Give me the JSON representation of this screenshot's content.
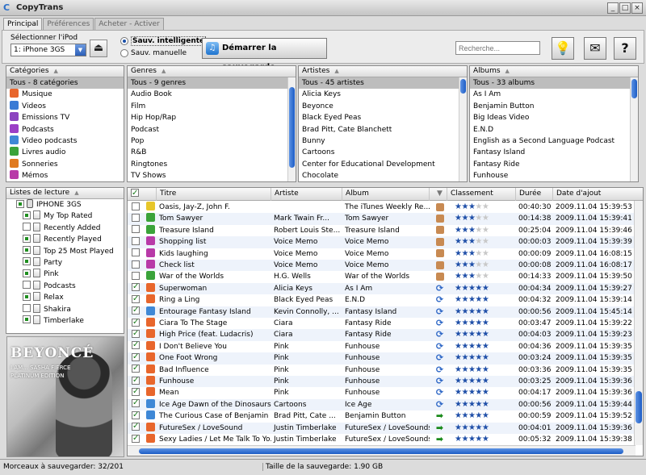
{
  "app": {
    "title": "CopyTrans",
    "window_controls": [
      "_",
      "□",
      "×"
    ]
  },
  "tabs": [
    {
      "label": "Principal"
    },
    {
      "label": "Préférences"
    },
    {
      "label": "Acheter - Activer"
    }
  ],
  "toolbar": {
    "ipod_label": "Sélectionner l'iPod",
    "ipod_selected": "1: iPhone 3GS",
    "radio_smart": "Sauv. intelligente",
    "radio_manual": "Sauv. manuelle",
    "start_label": "Démarrer la sauvegarde",
    "search_placeholder": "Recherche..."
  },
  "categories": {
    "header": "Catégories",
    "items": [
      {
        "label": "Tous - 8 catégories",
        "color": ""
      },
      {
        "label": "Musique",
        "color": "#e8662c"
      },
      {
        "label": "Videos",
        "color": "#3a7bd5"
      },
      {
        "label": "Emissions TV",
        "color": "#8c44c0"
      },
      {
        "label": "Podcasts",
        "color": "#9b3fc6"
      },
      {
        "label": "Video podcasts",
        "color": "#3f88d6"
      },
      {
        "label": "Livres audio",
        "color": "#3aa33a"
      },
      {
        "label": "Sonneries",
        "color": "#e07a1f"
      },
      {
        "label": "Mémos",
        "color": "#b83aa8"
      }
    ]
  },
  "genres": {
    "header": "Genres",
    "items": [
      "Tous - 9 genres",
      "Audio Book",
      "Film",
      "Hip Hop/Rap",
      "Podcast",
      "Pop",
      "R&B",
      "Ringtones",
      "TV Shows"
    ]
  },
  "artists": {
    "header": "Artistes",
    "items": [
      "Tous - 45 artistes",
      "Alicia Keys",
      "Beyonce",
      "Black Eyed Peas",
      "Brad Pitt, Cate Blanchett",
      "Bunny",
      "Cartoons",
      "Center for Educational Development",
      "Chocolate"
    ]
  },
  "albums": {
    "header": "Albums",
    "items": [
      "Tous - 33 albums",
      "As I Am",
      "Benjamin Button",
      "Big Ideas Video",
      "E.N.D",
      "English as a Second Language Podcast",
      "Fantasy Island",
      "Fantasy Ride",
      "Funhouse"
    ]
  },
  "playlists": {
    "header": "Listes de lecture",
    "device": "IPHONE 3GS",
    "items": [
      {
        "label": "My Top Rated",
        "state": "on"
      },
      {
        "label": "Recently Added",
        "state": "off"
      },
      {
        "label": "Recently Played",
        "state": "on"
      },
      {
        "label": "Top 25 Most Played",
        "state": "on"
      },
      {
        "label": "Party",
        "state": "on"
      },
      {
        "label": "Pink",
        "state": "on"
      },
      {
        "label": "Podcasts",
        "state": "off"
      },
      {
        "label": "Relax",
        "state": "on"
      },
      {
        "label": "Shakira",
        "state": "off"
      },
      {
        "label": "Timberlake",
        "state": "on"
      }
    ]
  },
  "album_art": {
    "line1": "BEYONCÉ",
    "line2": "I AM... SASHA FIERCE",
    "line3": "PLATINUM EDITION"
  },
  "tracks": {
    "headers": {
      "title": "Titre",
      "artist": "Artiste",
      "album": "Album",
      "rating": "Classement",
      "duration": "Durée",
      "added": "Date d'ajout"
    },
    "rows": [
      {
        "checked": false,
        "icon": "#e7c62a",
        "title": "Oasis, Jay-Z, John F.",
        "artist": "",
        "album": "The iTunes Weekly Re...",
        "status": "thumb",
        "rating": 3,
        "duration": "00:40:30",
        "added": "2009.11.04 15:39:53"
      },
      {
        "checked": false,
        "icon": "#3aa33a",
        "title": "Tom Sawyer",
        "artist": "Mark Twain      Fr...",
        "album": "Tom Sawyer",
        "status": "thumb",
        "rating": 3,
        "duration": "00:14:38",
        "added": "2009.11.04 15:39:41"
      },
      {
        "checked": false,
        "icon": "#3aa33a",
        "title": "Treasure Island",
        "artist": "Robert Louis Ste...",
        "album": "Treasure Island",
        "status": "thumb",
        "rating": 3,
        "duration": "00:25:04",
        "added": "2009.11.04 15:39:46"
      },
      {
        "checked": false,
        "icon": "#b83aa8",
        "title": "Shopping list",
        "artist": "Voice Memo",
        "album": "Voice Memo",
        "status": "thumb",
        "rating": 3,
        "duration": "00:00:03",
        "added": "2009.11.04 15:39:39"
      },
      {
        "checked": false,
        "icon": "#b83aa8",
        "title": "Kids laughing",
        "artist": "Voice Memo",
        "album": "Voice Memo",
        "status": "thumb",
        "rating": 3,
        "duration": "00:00:09",
        "added": "2009.11.04 16:08:15"
      },
      {
        "checked": false,
        "icon": "#b83aa8",
        "title": "Check list",
        "artist": "Voice Memo",
        "album": "Voice Memo",
        "status": "thumb",
        "rating": 3,
        "duration": "00:00:08",
        "added": "2009.11.04 16:08:17"
      },
      {
        "checked": false,
        "icon": "#3aa33a",
        "title": "War of the Worlds",
        "artist": "H.G. Wells",
        "album": "War of the Worlds",
        "status": "thumb",
        "rating": 3,
        "duration": "00:14:33",
        "added": "2009.11.04 15:39:50"
      },
      {
        "checked": true,
        "icon": "#e8662c",
        "title": "Superwoman",
        "artist": "Alicia Keys",
        "album": "As I Am",
        "status": "sync",
        "rating": 5,
        "duration": "00:04:34",
        "added": "2009.11.04 15:39:27"
      },
      {
        "checked": true,
        "icon": "#e8662c",
        "title": "Ring a Ling",
        "artist": "Black Eyed Peas",
        "album": "E.N.D",
        "status": "sync",
        "rating": 5,
        "duration": "00:04:32",
        "added": "2009.11.04 15:39:14"
      },
      {
        "checked": true,
        "icon": "#3f88d6",
        "title": "Entourage Fantasy Island",
        "artist": "Kevin Connolly, ...",
        "album": "Fantasy Island",
        "status": "sync",
        "rating": 5,
        "duration": "00:00:56",
        "added": "2009.11.04 15:45:14"
      },
      {
        "checked": true,
        "icon": "#e8662c",
        "title": "Ciara To The Stage",
        "artist": "Ciara",
        "album": "Fantasy Ride",
        "status": "sync",
        "rating": 5,
        "duration": "00:03:47",
        "added": "2009.11.04 15:39:22"
      },
      {
        "checked": true,
        "icon": "#e8662c",
        "title": "High Price (feat. Ludacris)",
        "artist": "Ciara",
        "album": "Fantasy Ride",
        "status": "sync",
        "rating": 5,
        "duration": "00:04:03",
        "added": "2009.11.04 15:39:23"
      },
      {
        "checked": true,
        "icon": "#e8662c",
        "title": "I Don't Believe You",
        "artist": "Pink",
        "album": "Funhouse",
        "status": "sync",
        "rating": 5,
        "duration": "00:04:36",
        "added": "2009.11.04 15:39:35"
      },
      {
        "checked": true,
        "icon": "#e8662c",
        "title": "One Foot Wrong",
        "artist": "Pink",
        "album": "Funhouse",
        "status": "sync",
        "rating": 5,
        "duration": "00:03:24",
        "added": "2009.11.04 15:39:35"
      },
      {
        "checked": true,
        "icon": "#e8662c",
        "title": "Bad Influence",
        "artist": "Pink",
        "album": "Funhouse",
        "status": "sync",
        "rating": 5,
        "duration": "00:03:36",
        "added": "2009.11.04 15:39:35"
      },
      {
        "checked": true,
        "icon": "#e8662c",
        "title": "Funhouse",
        "artist": "Pink",
        "album": "Funhouse",
        "status": "sync",
        "rating": 5,
        "duration": "00:03:25",
        "added": "2009.11.04 15:39:36"
      },
      {
        "checked": true,
        "icon": "#e8662c",
        "title": "Mean",
        "artist": "Pink",
        "album": "Funhouse",
        "status": "sync",
        "rating": 5,
        "duration": "00:04:17",
        "added": "2009.11.04 15:39:36"
      },
      {
        "checked": true,
        "icon": "#3f88d6",
        "title": "Ice Age Dawn of the Dinosaurs",
        "artist": "Cartoons",
        "album": "Ice Age",
        "status": "sync",
        "rating": 5,
        "duration": "00:00:56",
        "added": "2009.11.04 15:39:44"
      },
      {
        "checked": true,
        "icon": "#3f88d6",
        "title": "The Curious Case of Benjamin B...",
        "artist": "Brad Pitt, Cate ...",
        "album": "Benjamin Button",
        "status": "arrow",
        "rating": 5,
        "duration": "00:00:59",
        "added": "2009.11.04 15:39:52"
      },
      {
        "checked": true,
        "icon": "#e8662c",
        "title": "FutureSex / LoveSound",
        "artist": "Justin Timberlake",
        "album": "FutureSex / LoveSounds",
        "status": "arrow",
        "rating": 5,
        "duration": "00:04:01",
        "added": "2009.11.04 15:39:36"
      },
      {
        "checked": true,
        "icon": "#e8662c",
        "title": "Sexy Ladies / Let Me Talk To Yo...",
        "artist": "Justin Timberlake",
        "album": "FutureSex / LoveSounds",
        "status": "arrow",
        "rating": 5,
        "duration": "00:05:32",
        "added": "2009.11.04 15:39:38"
      }
    ]
  },
  "status": {
    "left": "Morceaux à sauvegarder: 32/201",
    "right": "Taille de la sauvegarde: 1.90 GB"
  }
}
